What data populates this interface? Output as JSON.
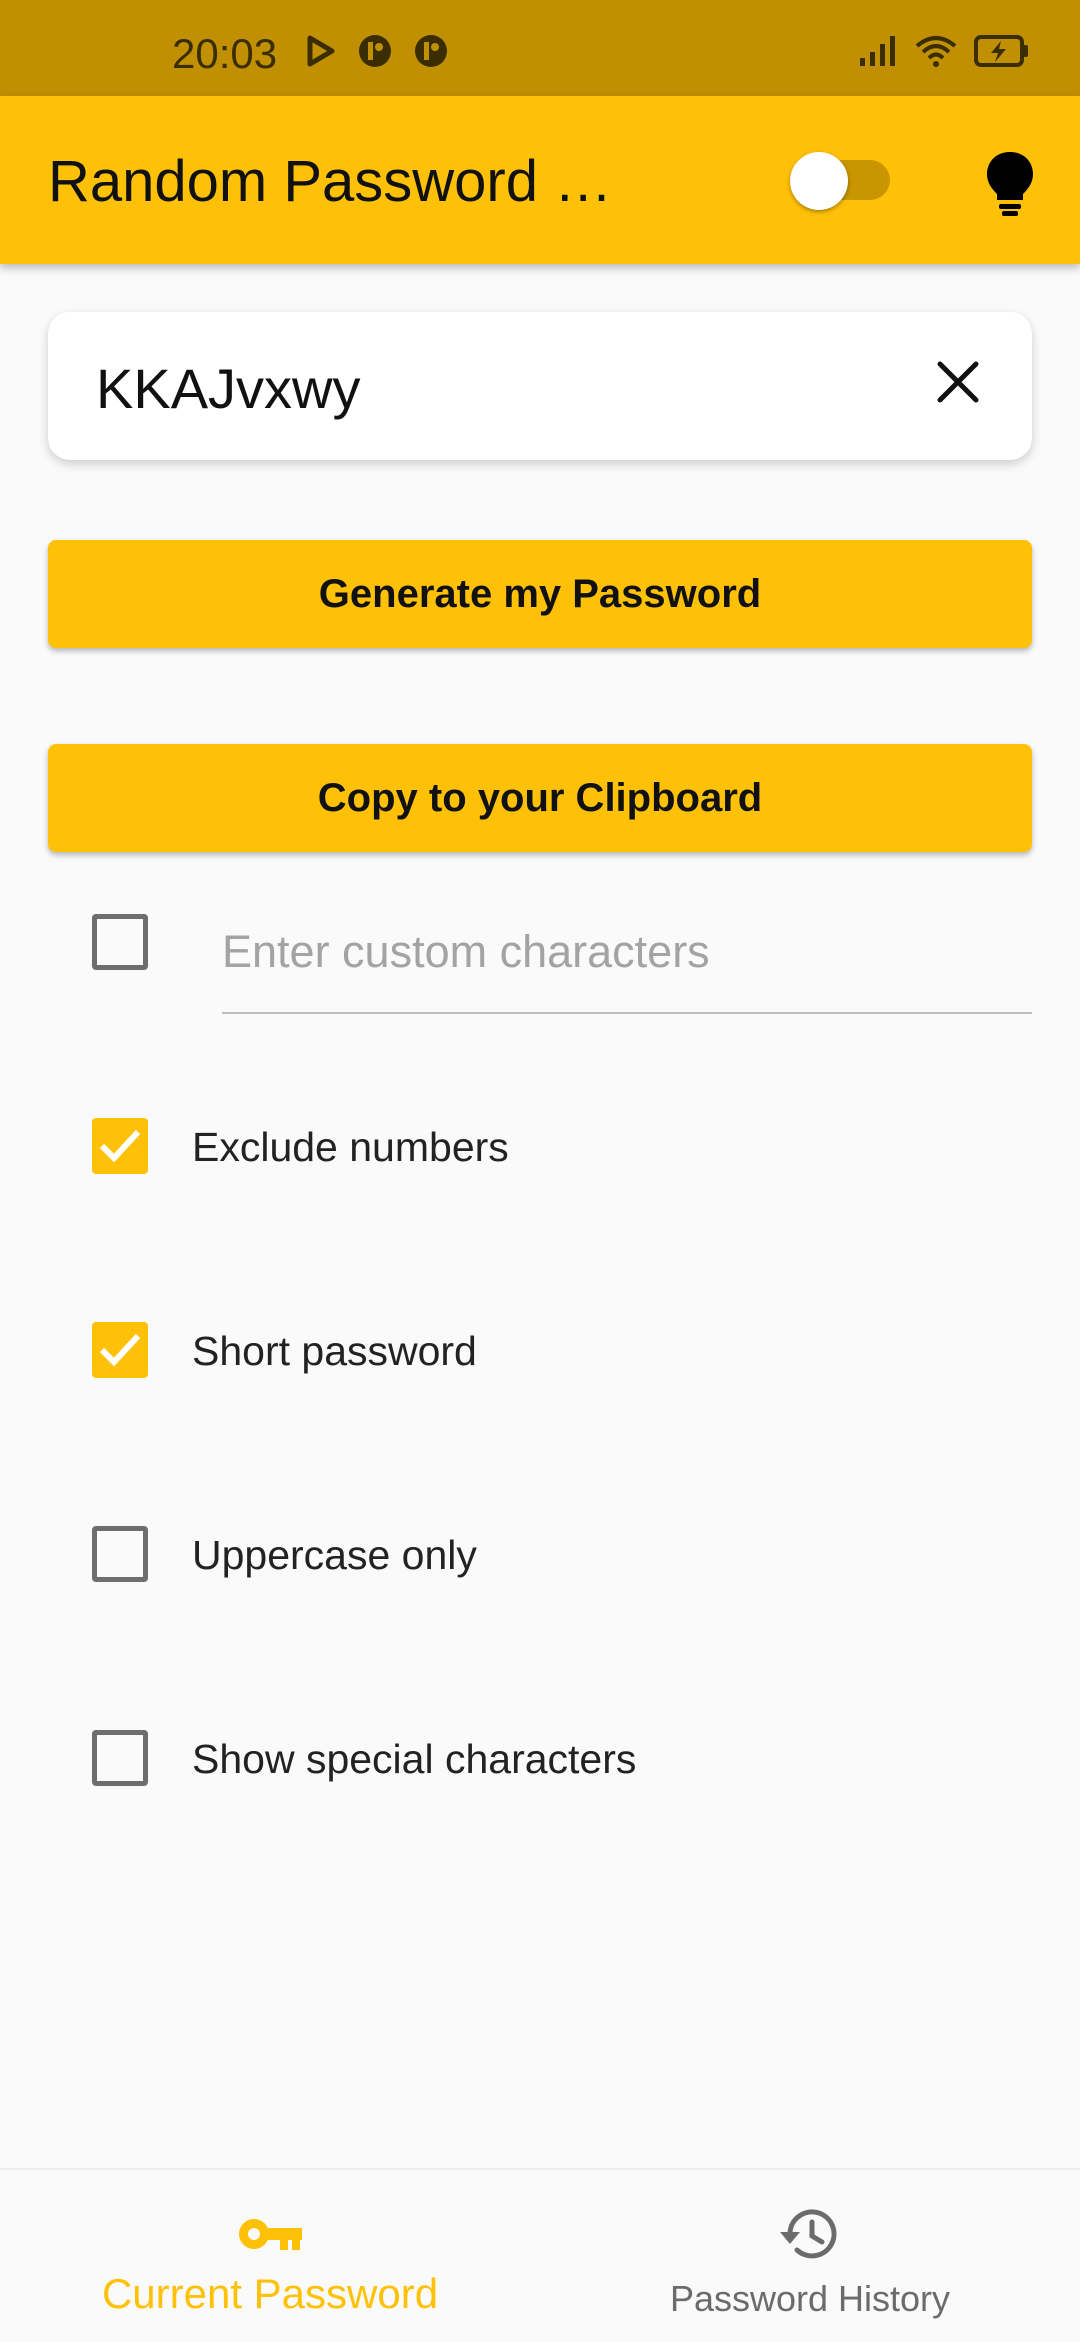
{
  "status_bar": {
    "time": "20:03",
    "icons": [
      "play-icon",
      "notification-icon",
      "notification-icon",
      "signal-icon",
      "wifi-icon",
      "battery-charging-icon"
    ]
  },
  "app_bar": {
    "title": "Random Password …",
    "toggle_state": "off",
    "theme_icon": "lightbulb-icon"
  },
  "password": {
    "value": "KKAJvxwy",
    "clear_icon": "close-icon"
  },
  "buttons": {
    "generate": "Generate my Password",
    "copy": "Copy to your Clipboard"
  },
  "custom_characters": {
    "placeholder": "Enter custom characters",
    "checked": false
  },
  "options": [
    {
      "label": "Exclude numbers",
      "checked": true
    },
    {
      "label": "Short password",
      "checked": true
    },
    {
      "label": "Uppercase only",
      "checked": false
    },
    {
      "label": "Show special characters",
      "checked": false
    }
  ],
  "bottom_nav": {
    "items": [
      {
        "label": "Current Password",
        "icon": "key-icon",
        "active": true
      },
      {
        "label": "Password History",
        "icon": "history-icon",
        "active": false
      }
    ]
  },
  "colors": {
    "accent": "#ffc107",
    "status_bar": "#c09002",
    "background": "#fafafa"
  }
}
